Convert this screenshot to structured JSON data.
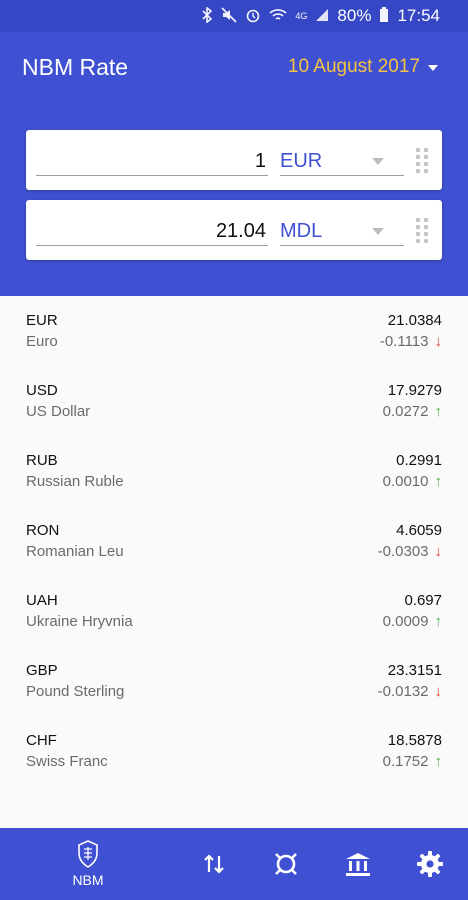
{
  "status_bar": {
    "battery": "80%",
    "time": "17:54",
    "icons": [
      "bluetooth-icon",
      "mute-icon",
      "alarm-icon",
      "wifi-icon",
      "4g-icon",
      "signal-icon",
      "battery-icon"
    ]
  },
  "header": {
    "title": "NBM Rate",
    "date": "10 August 2017"
  },
  "converter": {
    "from_amount": "1",
    "from_currency": "EUR",
    "to_amount": "21.04",
    "to_currency": "MDL"
  },
  "rates": [
    {
      "code": "EUR",
      "name": "Euro",
      "value": "21.0384",
      "change": "-0.1113",
      "direction": "down"
    },
    {
      "code": "USD",
      "name": "US Dollar",
      "value": "17.9279",
      "change": "0.0272",
      "direction": "up"
    },
    {
      "code": "RUB",
      "name": "Russian Ruble",
      "value": "0.2991",
      "change": "0.0010",
      "direction": "up"
    },
    {
      "code": "RON",
      "name": "Romanian Leu",
      "value": "4.6059",
      "change": "-0.0303",
      "direction": "down"
    },
    {
      "code": "UAH",
      "name": "Ukraine Hryvnia",
      "value": "0.697",
      "change": "0.0009",
      "direction": "up"
    },
    {
      "code": "GBP",
      "name": "Pound Sterling",
      "value": "23.3151",
      "change": "-0.0132",
      "direction": "down"
    },
    {
      "code": "CHF",
      "name": "Swiss Franc",
      "value": "18.5878",
      "change": "0.1752",
      "direction": "up"
    }
  ],
  "bottom_nav": {
    "nbm_label": "NBM",
    "items": [
      "nbm-logo-icon",
      "swap-icon",
      "currency-icon",
      "bank-icon",
      "settings-icon"
    ]
  },
  "colors": {
    "primary": "#3f51d2",
    "status_bar": "#3547c5",
    "date_accent": "#f5c242",
    "up": "#4caf50",
    "down": "#e53935"
  }
}
